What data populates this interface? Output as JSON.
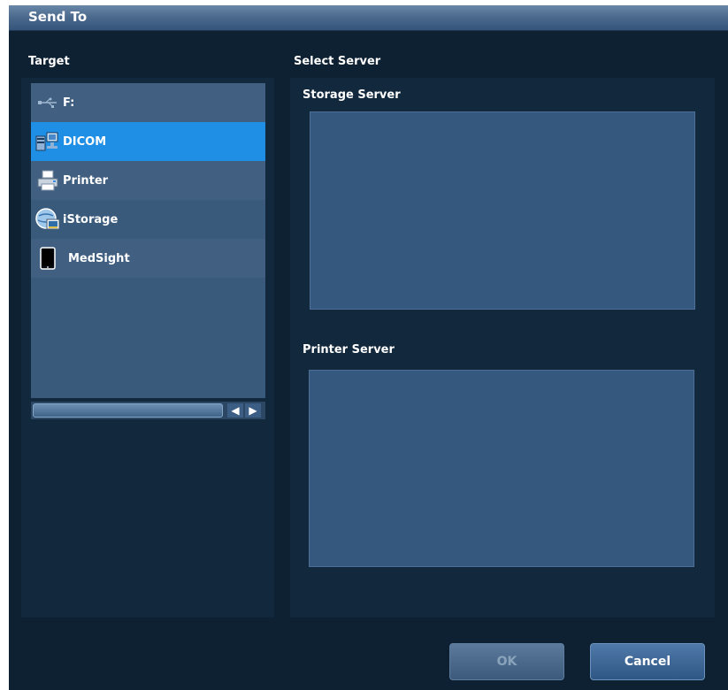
{
  "dialog": {
    "title": "Send To",
    "ok_label": "OK",
    "cancel_label": "Cancel"
  },
  "target": {
    "label": "Target",
    "selected": "DICOM",
    "items": [
      {
        "label": "F:",
        "icon": "usb-drive-icon"
      },
      {
        "label": "DICOM",
        "icon": "dicom-icon"
      },
      {
        "label": "Printer",
        "icon": "printer-icon"
      },
      {
        "label": "iStorage",
        "icon": "istorage-icon"
      },
      {
        "label": "MedSight",
        "icon": "mobile-device-icon"
      }
    ]
  },
  "server": {
    "label": "Select Server",
    "storage_label": "Storage Server",
    "printer_label": "Printer Server"
  },
  "colors": {
    "background": "#0e2133",
    "panel": "#12283c",
    "list": "#3a5a7c",
    "selected": "#1f8fe6",
    "server_box": "#35587e"
  }
}
